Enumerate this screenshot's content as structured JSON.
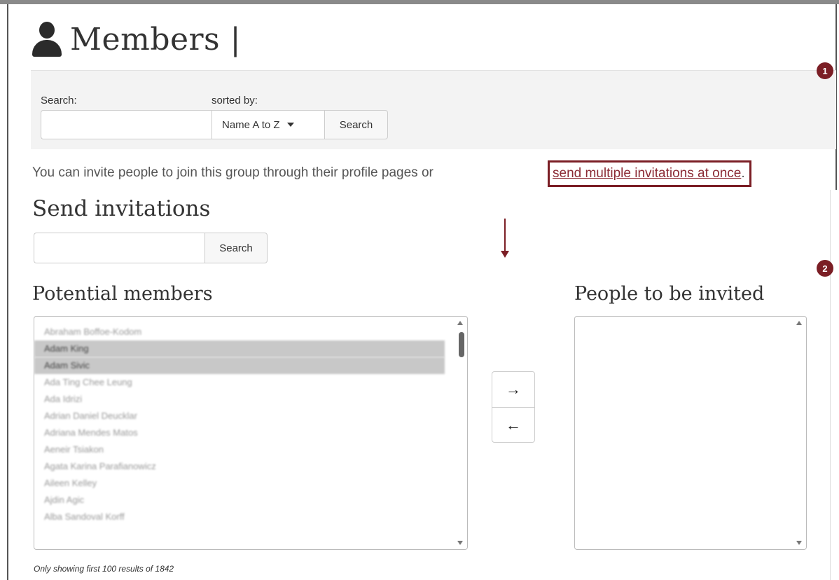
{
  "page": {
    "title": "Members |",
    "title_icon": "person-icon"
  },
  "search_panel": {
    "search_label": "Search:",
    "search_value": "",
    "sorted_label": "sorted by:",
    "sort_selected": "Name A to Z",
    "search_button": "Search"
  },
  "annotations": {
    "badge1": "1",
    "badge2": "2",
    "accent_color": "#7b1e25"
  },
  "invite": {
    "text": "You can invite people to join this group through their profile pages or ",
    "link": "send multiple invitations at once",
    "suffix": "."
  },
  "send_invitations": {
    "title": "Send invitations",
    "search_value": "",
    "search_button": "Search"
  },
  "potential": {
    "title": "Potential members",
    "items": [
      {
        "label": "Abraham Boffoe-Kodom",
        "selected": false
      },
      {
        "label": "Adam King",
        "selected": true
      },
      {
        "label": "Adam Sivic",
        "selected": true
      },
      {
        "label": "Ada Ting Chee Leung",
        "selected": false
      },
      {
        "label": "Ada Idrizi",
        "selected": false
      },
      {
        "label": "Adrian Daniel Deucklar",
        "selected": false
      },
      {
        "label": "Adriana Mendes Matos",
        "selected": false
      },
      {
        "label": "Aeneir Tsiakon",
        "selected": false
      },
      {
        "label": "Agata Karina Parafianowicz",
        "selected": false
      },
      {
        "label": "Aileen Kelley",
        "selected": false
      },
      {
        "label": "Ajdin Agic",
        "selected": false
      },
      {
        "label": "Alba Sandoval Korff",
        "selected": false
      }
    ]
  },
  "invited": {
    "title": "People to be invited",
    "items": []
  },
  "transfer": {
    "add_glyph": "→",
    "remove_glyph": "←"
  },
  "footer": {
    "note": "Only showing first 100 results of 1842"
  }
}
